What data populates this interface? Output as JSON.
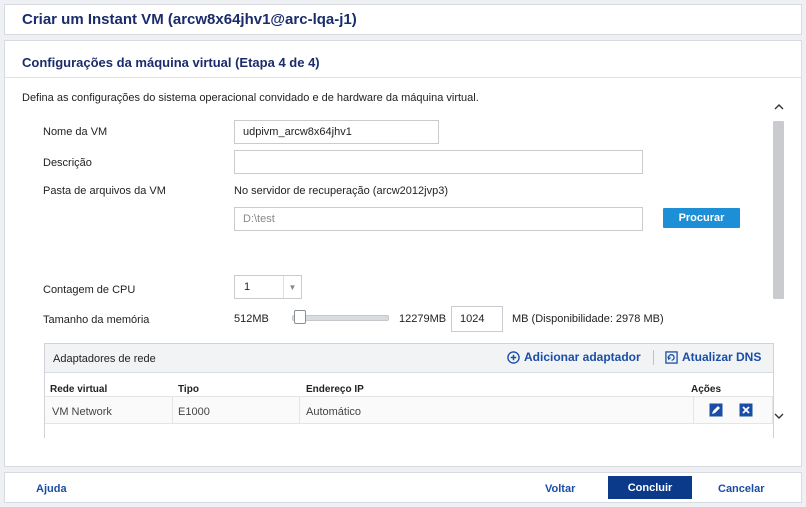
{
  "window": {
    "title": "Criar um Instant VM (arcw8x64jhv1@arc-lqa-j1)"
  },
  "panel": {
    "title": "Configurações da máquina virtual (Etapa 4 de 4)",
    "intro": "Defina as configurações do sistema operacional convidado e de hardware da máquina virtual."
  },
  "form": {
    "vm_name_label": "Nome da VM",
    "vm_name_value": "udpivm_arcw8x64jhv1",
    "description_label": "Descrição",
    "description_value": "",
    "folder_label": "Pasta de arquivos da VM",
    "folder_server_text": "No servidor de recuperação (arcw2012jvp3)",
    "folder_value": "D:\\test",
    "browse_label": "Procurar",
    "cpu_label": "Contagem de CPU",
    "cpu_value": "1",
    "memory_label": "Tamanho da memória",
    "memory_min": "512MB",
    "memory_max": "12279MB",
    "memory_value": "1024",
    "memory_available": "MB (Disponibilidade: 2978 MB)",
    "memory_fraction": 0.044
  },
  "network": {
    "title": "Adaptadores de rede",
    "add_label": "Adicionar adaptador",
    "dns_label": "Atualizar DNS",
    "columns": [
      "Rede virtual",
      "Tipo",
      "Endereço IP",
      "Ações"
    ],
    "rows": [
      {
        "network": "VM Network",
        "type": "E1000",
        "ip": "Automático"
      }
    ]
  },
  "footer": {
    "help": "Ajuda",
    "back": "Voltar",
    "finish": "Concluir",
    "cancel": "Cancelar"
  },
  "colors": {
    "accent": "#1d8fd6",
    "primary": "#0c3a8a",
    "title": "#1a2c6b",
    "link": "#1a4ea6"
  },
  "icons": [
    "plus-circle-icon",
    "dns-refresh-icon",
    "edit-icon",
    "delete-icon",
    "chevron-up-icon",
    "chevron-down-icon",
    "dropdown-arrow-icon"
  ]
}
